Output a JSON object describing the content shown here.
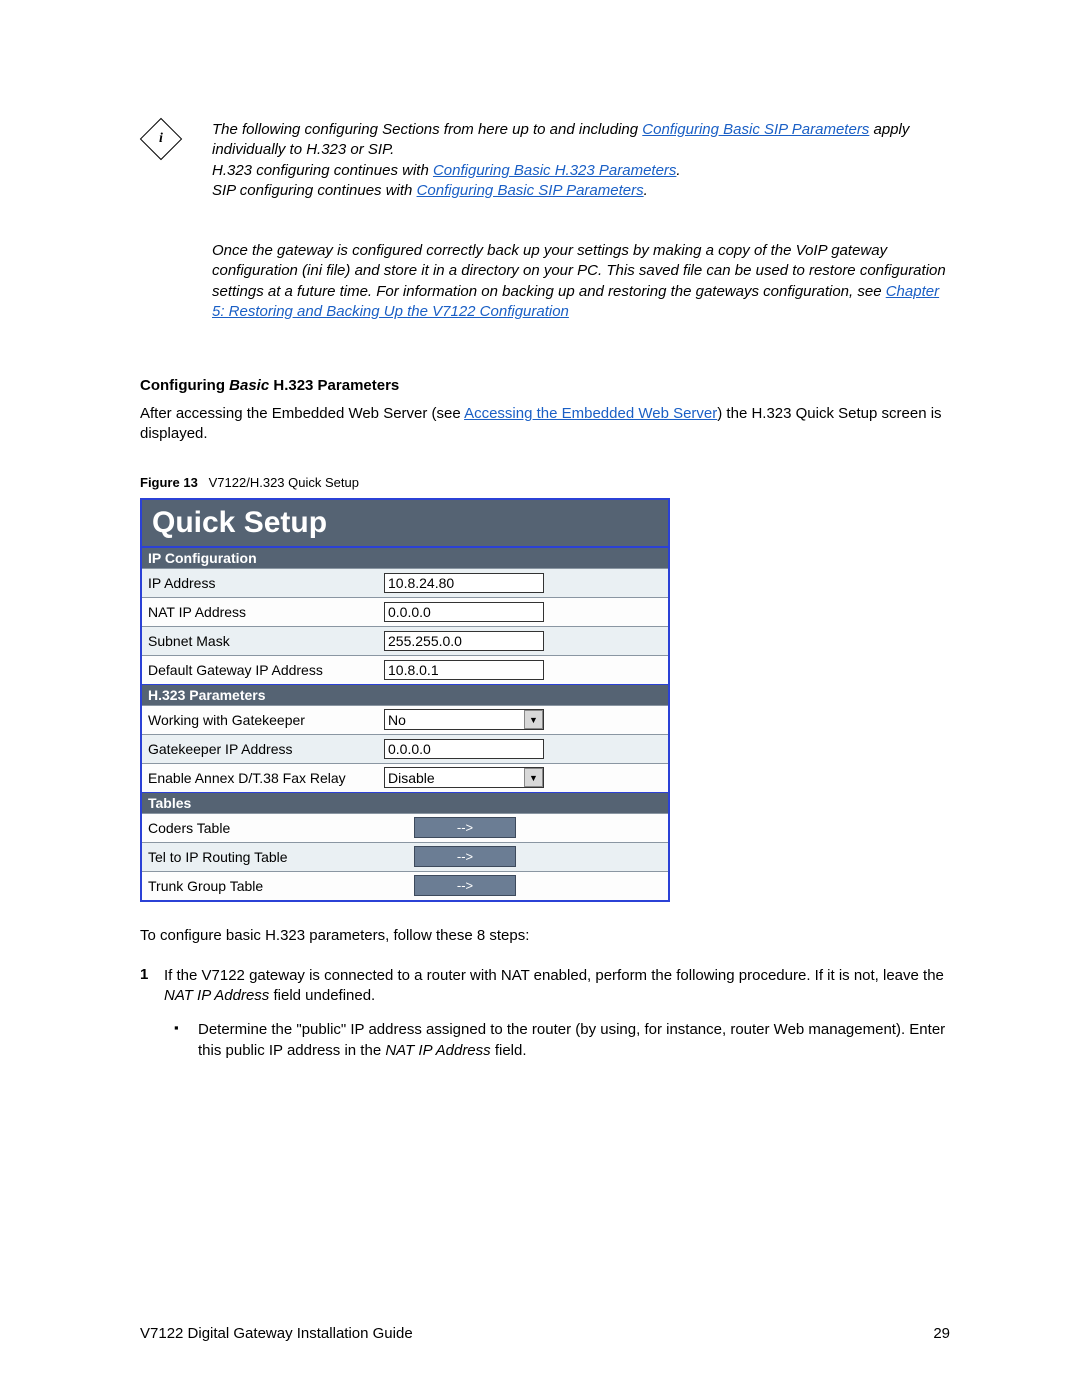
{
  "note": {
    "line1a": "The following configuring Sections from here up to and including ",
    "link1": "Configuring Basic SIP Parameters",
    "line1b": " apply individually to H.323 or SIP.",
    "line2a": "H.323 configuring continues with ",
    "link2": "Configuring Basic H.323 Parameters",
    "line2b": ".",
    "line3a": "SIP configuring continues with ",
    "link3": "Configuring Basic SIP Parameters",
    "line3b": ".",
    "para2a": "Once the gateway is configured correctly back up your settings by making a copy of the VoIP gateway configuration (ini file) and store it in a directory on your PC. This saved file can be used to restore configuration settings at a future time. For information on backing up and restoring the gateways configuration, see ",
    "link4": "Chapter 5: Restoring and Backing Up the V7122 Configuration"
  },
  "heading": {
    "prefix": "Configuring ",
    "italic": "Basic",
    "suffix": " H.323 Parameters"
  },
  "intro": {
    "a": "After accessing the Embedded Web Server (see ",
    "link": "Accessing the Embedded Web Server",
    "b": ") the H.323 Quick Setup screen is displayed."
  },
  "fig": {
    "label": "Figure 13",
    "caption": "V7122/H.323 Quick Setup"
  },
  "quicksetup": {
    "title": "Quick Setup",
    "sections": {
      "ip": {
        "head": "IP Configuration",
        "rows": [
          {
            "label": "IP Address",
            "value": "10.8.24.80",
            "type": "input"
          },
          {
            "label": "NAT IP Address",
            "value": "0.0.0.0",
            "type": "input"
          },
          {
            "label": "Subnet Mask",
            "value": "255.255.0.0",
            "type": "input"
          },
          {
            "label": "Default Gateway IP Address",
            "value": "10.8.0.1",
            "type": "input"
          }
        ]
      },
      "h323": {
        "head": "H.323 Parameters",
        "rows": [
          {
            "label": "Working with Gatekeeper",
            "value": "No",
            "type": "select"
          },
          {
            "label": "Gatekeeper IP Address",
            "value": "0.0.0.0",
            "type": "input"
          },
          {
            "label": "Enable Annex D/T.38 Fax Relay",
            "value": "Disable",
            "type": "select"
          }
        ]
      },
      "tables": {
        "head": "Tables",
        "rows": [
          {
            "label": "Coders Table",
            "value": "-->",
            "type": "button"
          },
          {
            "label": "Tel to IP Routing Table",
            "value": "-->",
            "type": "button"
          },
          {
            "label": "Trunk Group Table",
            "value": "-->",
            "type": "button"
          }
        ]
      }
    }
  },
  "after_fig": "To configure basic H.323 parameters, follow these 8 steps:",
  "step1": {
    "num": "1",
    "a": "If the V7122 gateway is connected to a router with NAT enabled, perform the following procedure. If it is not, leave the ",
    "field": "NAT IP Address",
    "b": " field undefined."
  },
  "bullet": {
    "a": "Determine the \"public\" IP address assigned to the router (by using, for instance, router Web management). Enter this public IP address in the ",
    "field": "NAT IP Address",
    "b": " field."
  },
  "footer": {
    "left": "V7122 Digital Gateway Installation Guide",
    "right": "29"
  },
  "icons": {
    "info_letter": "i"
  }
}
